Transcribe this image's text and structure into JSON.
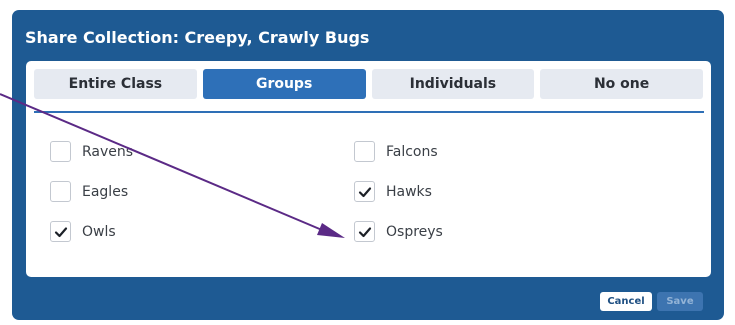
{
  "dialog": {
    "title": "Share Collection: Creepy, Crawly Bugs"
  },
  "tabs": [
    {
      "label": "Entire Class",
      "active": false
    },
    {
      "label": "Groups",
      "active": true
    },
    {
      "label": "Individuals",
      "active": false
    },
    {
      "label": "No one",
      "active": false
    }
  ],
  "groups": {
    "left": [
      {
        "label": "Ravens",
        "checked": false
      },
      {
        "label": "Eagles",
        "checked": false
      },
      {
        "label": "Owls",
        "checked": true
      }
    ],
    "right": [
      {
        "label": "Falcons",
        "checked": false
      },
      {
        "label": "Hawks",
        "checked": true
      },
      {
        "label": "Ospreys",
        "checked": true
      }
    ]
  },
  "footer": {
    "cancel_label": "Cancel",
    "save_label": "Save"
  },
  "colors": {
    "dialog_bg": "#1e5a93",
    "tab_active": "#2e70b8",
    "tab_inactive": "#e6eaf1",
    "annotation_arrow": "#5b2a86"
  },
  "icons": {
    "checkmark": "check-icon"
  }
}
